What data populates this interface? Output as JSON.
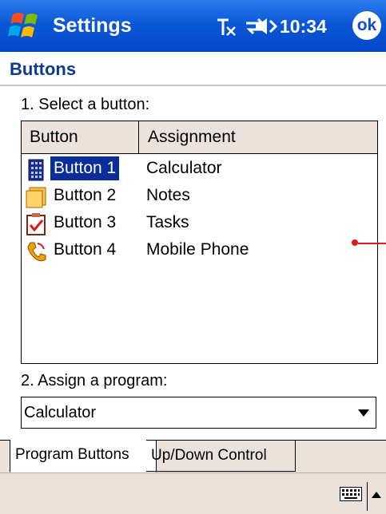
{
  "titlebar": {
    "app_title": "Settings",
    "clock": "10:34",
    "ok_label": "ok",
    "status_icons": [
      "signal-off-icon",
      "connectivity-icon",
      "volume-icon"
    ]
  },
  "page": {
    "title": "Buttons"
  },
  "section1": {
    "label": "1. Select a button:"
  },
  "list": {
    "headers": [
      "Button",
      "Assignment"
    ],
    "rows": [
      {
        "button": "Button 1",
        "assignment": "Calculator",
        "icon": "calculator-icon",
        "selected": true
      },
      {
        "button": "Button 2",
        "assignment": "Notes",
        "icon": "notes-icon",
        "selected": false
      },
      {
        "button": "Button 3",
        "assignment": "Tasks",
        "icon": "tasks-icon",
        "selected": false
      },
      {
        "button": "Button 4",
        "assignment": "Mobile Phone",
        "icon": "phone-icon",
        "selected": false
      }
    ]
  },
  "section2": {
    "label": "2. Assign a program:"
  },
  "program_select": {
    "value": "Calculator"
  },
  "tabs": [
    {
      "label": "Program Buttons",
      "active": true
    },
    {
      "label": "Up/Down Control",
      "active": false
    }
  ],
  "colors": {
    "titlebar": "#0a58d6",
    "selection": "#0a2d9a",
    "chrome": "#ece2dc",
    "heading": "#0b3b8f"
  }
}
